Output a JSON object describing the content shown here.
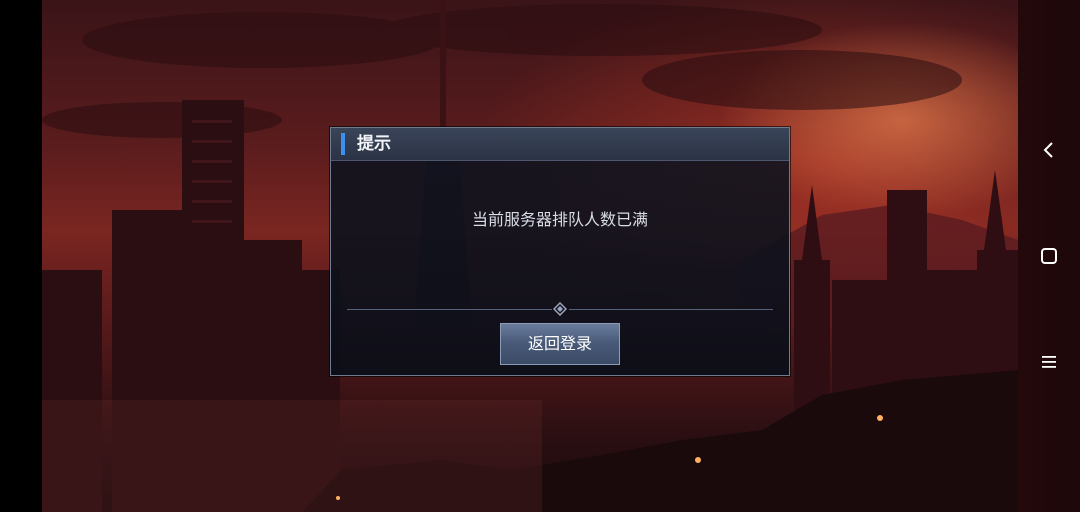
{
  "dialog": {
    "title": "提示",
    "message": "当前服务器排队人数已满",
    "button_label": "返回登录"
  },
  "navigation": {
    "back_icon": "chevron-left-icon",
    "home_icon": "square-icon",
    "menu_icon": "hamburger-icon"
  },
  "colors": {
    "accent": "#3d8ff0",
    "dialog_bg": "#0e1420",
    "header_bg": "#333d51"
  }
}
